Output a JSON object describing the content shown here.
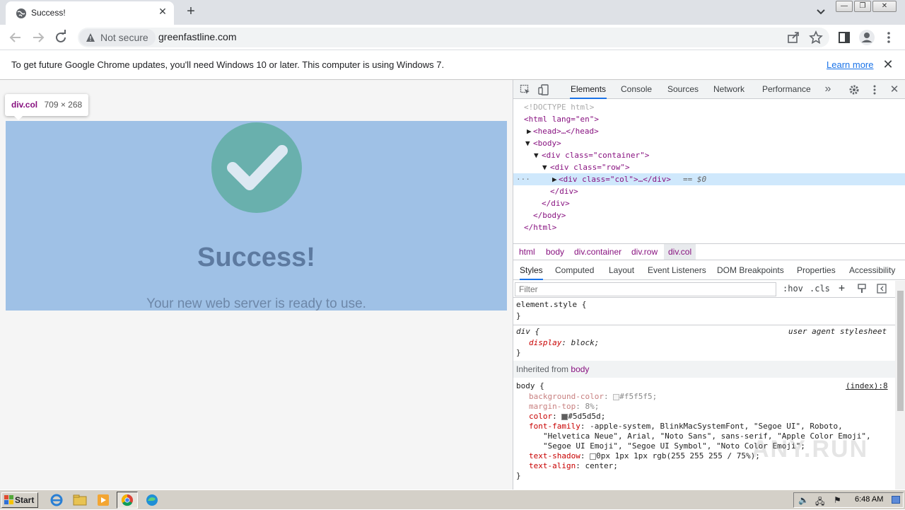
{
  "browser": {
    "tab_title": "Success!",
    "security_label": "Not secure",
    "url": "greenfastline.com"
  },
  "infobar": {
    "message": "To get future Google Chrome updates, you'll need Windows 10 or later. This computer is using Windows 7.",
    "learn_more": "Learn more"
  },
  "page": {
    "heading": "Success!",
    "subtext": "Your new web server is ready to use.",
    "tooltip_tag": "div.col",
    "tooltip_dims": "709 × 268",
    "highlight_color": "#9fc1e6",
    "check_color": "#69b0ad"
  },
  "devtools": {
    "tabs": [
      "Elements",
      "Console",
      "Sources",
      "Network",
      "Performance"
    ],
    "dom": {
      "doctype": "<!DOCTYPE html>",
      "html_open": "<html lang=\"en\">",
      "head": "<head>…</head>",
      "body_open": "<body>",
      "container_open": "<div class=\"container\">",
      "row_open": "<div class=\"row\">",
      "col": "<div class=\"col\">…</div>",
      "col_suffix": "== $0",
      "row_close": "</div>",
      "container_close": "</div>",
      "body_close": "</body>",
      "html_close": "</html>"
    },
    "breadcrumbs": [
      "html",
      "body",
      "div.container",
      "div.row",
      "div.col"
    ],
    "style_tabs": [
      "Styles",
      "Computed",
      "Layout",
      "Event Listeners",
      "DOM Breakpoints",
      "Properties",
      "Accessibility"
    ],
    "filter_placeholder": "Filter",
    "filter_buttons": [
      ":hov",
      ".cls",
      "+"
    ],
    "styles": {
      "element_style": "element.style {",
      "close_brace": "}",
      "div_selector": "div {",
      "ua_label": "user agent stylesheet",
      "display_prop": "display",
      "display_val": "block;",
      "inherited_label": "Inherited from",
      "inherited_from": "body",
      "body_selector": "body {",
      "source_link": "(index):8",
      "props": [
        {
          "name": "background-color",
          "value": "#f5f5f5;",
          "swatch": "#f5f5f5",
          "faded": true
        },
        {
          "name": "margin-top",
          "value": "8%;",
          "faded": true
        },
        {
          "name": "color",
          "value": "#5d5d5d;",
          "swatch": "#5d5d5d",
          "faded": false
        },
        {
          "name": "font-family",
          "value": "-apple-system, BlinkMacSystemFont, \"Segoe UI\", Roboto,",
          "faded": false
        }
      ],
      "font_cont1": "\"Helvetica Neue\", Arial, \"Noto Sans\", sans-serif, \"Apple Color Emoji\",",
      "font_cont2": "\"Segoe UI Emoji\", \"Segoe UI Symbol\", \"Noto Color Emoji\";",
      "text_shadow_name": "text-shadow",
      "text_shadow_val": "0px 1px 1px rgb(255 255 255 / 75%);",
      "text_align_name": "text-align",
      "text_align_val": "center;"
    }
  },
  "taskbar": {
    "start": "Start",
    "clock": "6:48 AM"
  }
}
